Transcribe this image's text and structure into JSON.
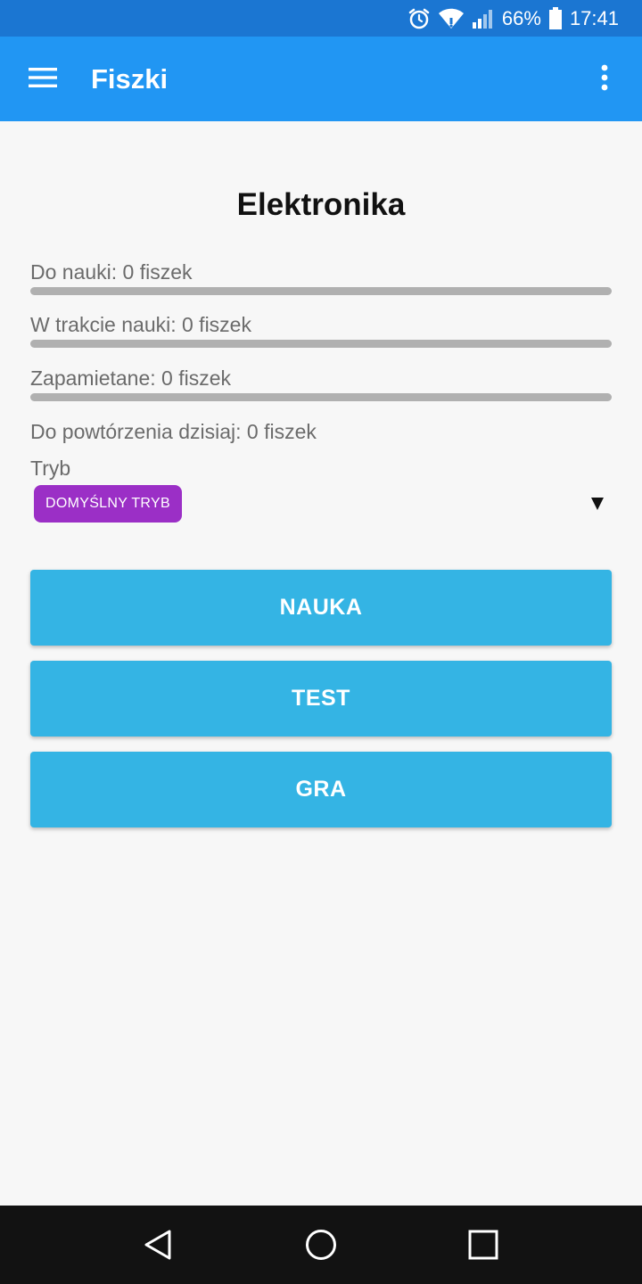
{
  "status_bar": {
    "battery": "66%",
    "time": "17:41",
    "icons": [
      "alarm-icon",
      "wifi-icon",
      "signal-icon",
      "battery-icon"
    ]
  },
  "app_bar": {
    "title": "Fiszki",
    "icons": [
      "menu-icon",
      "overflow-menu-icon"
    ]
  },
  "deck": {
    "title": "Elektronika",
    "stats": [
      {
        "label": "Do nauki: 0 fiszek",
        "progress": 0
      },
      {
        "label": "W trakcie nauki: 0 fiszek",
        "progress": 0
      },
      {
        "label": "Zapamietane: 0 fiszek",
        "progress": 0
      }
    ],
    "review_today": "Do powtórzenia dzisiaj: 0 fiszek"
  },
  "mode": {
    "label": "Tryb",
    "selected": "DOMYŚLNY TRYB",
    "chip_color": "#9b2fc6"
  },
  "actions": {
    "learn": "NAUKA",
    "test": "TEST",
    "game": "GRA",
    "color": "#34b4e4"
  },
  "colors": {
    "status_bar": "#1b76d2",
    "app_bar": "#2196f3"
  },
  "nav_bar": {
    "icons": [
      "back-icon",
      "home-icon",
      "recents-icon"
    ]
  }
}
